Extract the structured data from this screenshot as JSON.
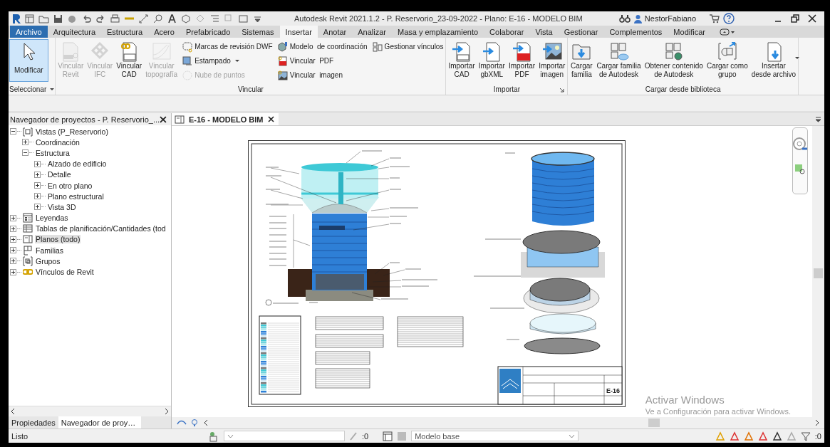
{
  "title_bar": {
    "title": "Autodesk Revit 2021.1.2 - P. Reservorio_23-09-2022 - Plano: E-16 - MODELO BIM",
    "user": "NestorFabiano"
  },
  "menu_tabs": [
    {
      "label": "Archivo",
      "kind": "file",
      "selected": false
    },
    {
      "label": "Arquitectura",
      "kind": "tab",
      "selected": false
    },
    {
      "label": "Estructura",
      "kind": "tab",
      "selected": false
    },
    {
      "label": "Acero",
      "kind": "tab",
      "selected": false
    },
    {
      "label": "Prefabricado",
      "kind": "tab",
      "selected": false
    },
    {
      "label": "Sistemas",
      "kind": "tab",
      "selected": false
    },
    {
      "label": "Insertar",
      "kind": "tab",
      "selected": true
    },
    {
      "label": "Anotar",
      "kind": "tab",
      "selected": false
    },
    {
      "label": "Analizar",
      "kind": "tab",
      "selected": false
    },
    {
      "label": "Masa y emplazamiento",
      "kind": "tab",
      "selected": false
    },
    {
      "label": "Colaborar",
      "kind": "tab",
      "selected": false
    },
    {
      "label": "Vista",
      "kind": "tab",
      "selected": false
    },
    {
      "label": "Gestionar",
      "kind": "tab",
      "selected": false
    },
    {
      "label": "Complementos",
      "kind": "tab",
      "selected": false
    },
    {
      "label": "Modificar",
      "kind": "tab",
      "selected": false
    }
  ],
  "ribbon_panels": [
    {
      "label": "Seleccionar",
      "dropdown": true,
      "launcher": false,
      "items": [
        {
          "kind": "large",
          "label": "Modificar",
          "active": true,
          "disabled": false,
          "dropdown": false
        }
      ]
    },
    {
      "label": "Vincular",
      "dropdown": false,
      "launcher": false,
      "items": [
        {
          "kind": "large",
          "label": "Vincular\nRevit",
          "active": false,
          "disabled": true,
          "dropdown": false
        },
        {
          "kind": "large",
          "label": "Vincular\nIFC",
          "active": false,
          "disabled": true,
          "dropdown": false
        },
        {
          "kind": "large",
          "label": "Vincular\nCAD",
          "active": false,
          "disabled": false,
          "dropdown": false
        },
        {
          "kind": "large",
          "label": "Vincular\ntopografía",
          "active": false,
          "disabled": true,
          "dropdown": false
        },
        {
          "kind": "stack",
          "items": [
            {
              "label": "Marcas de revisión DWF",
              "disabled": false,
              "dropdown": false
            },
            {
              "label": "Estampado",
              "disabled": false,
              "dropdown": true
            },
            {
              "label": "Nube de puntos",
              "disabled": true,
              "dropdown": false
            }
          ]
        },
        {
          "kind": "stack",
          "items": [
            {
              "label": "Modelo  de coordinación",
              "disabled": false,
              "dropdown": false
            },
            {
              "label": "Vincular  PDF",
              "disabled": false,
              "dropdown": false
            },
            {
              "label": "Vincular  imagen",
              "disabled": false,
              "dropdown": false
            }
          ]
        },
        {
          "kind": "stack",
          "items": [
            {
              "label": "Gestionar vínculos",
              "disabled": false,
              "dropdown": false
            }
          ]
        }
      ]
    },
    {
      "label": "Importar",
      "dropdown": false,
      "launcher": true,
      "items": [
        {
          "kind": "large",
          "label": "Importar\nCAD",
          "active": false,
          "disabled": false,
          "dropdown": false
        },
        {
          "kind": "large",
          "label": "Importar\ngbXML",
          "active": false,
          "disabled": false,
          "dropdown": false
        },
        {
          "kind": "large",
          "label": "Importar\nPDF",
          "active": false,
          "disabled": false,
          "dropdown": false
        },
        {
          "kind": "large",
          "label": "Importar\nimagen",
          "active": false,
          "disabled": false,
          "dropdown": false
        }
      ]
    },
    {
      "label": "Cargar desde biblioteca",
      "dropdown": false,
      "launcher": false,
      "items": [
        {
          "kind": "large",
          "label": "Cargar\nfamilia",
          "active": false,
          "disabled": false,
          "dropdown": false
        },
        {
          "kind": "large",
          "label": "Cargar familia\nde Autodesk",
          "active": false,
          "disabled": false,
          "dropdown": false
        },
        {
          "kind": "large",
          "label": "Obtener contenido\nde Autodesk",
          "active": false,
          "disabled": false,
          "dropdown": false
        },
        {
          "kind": "large",
          "label": "Cargar como\ngrupo",
          "active": false,
          "disabled": false,
          "dropdown": false
        },
        {
          "kind": "large",
          "label": "Insertar\ndesde archivo",
          "active": false,
          "disabled": false,
          "dropdown": true
        }
      ]
    }
  ],
  "project_browser": {
    "title": "Navegador de proyectos - P. Reservorio_...",
    "tree": [
      {
        "label": "Vistas (P_Reservorio)",
        "expanded": true,
        "selected": false,
        "children": [
          {
            "label": "Coordinación",
            "expanded": false,
            "selected": false
          },
          {
            "label": "Estructura",
            "expanded": true,
            "selected": false,
            "children": [
              {
                "label": "Alzado de edificio",
                "expanded": false,
                "selected": false
              },
              {
                "label": "Detalle",
                "expanded": false,
                "selected": false
              },
              {
                "label": "En otro plano",
                "expanded": false,
                "selected": false
              },
              {
                "label": "Plano estructural",
                "expanded": false,
                "selected": false
              },
              {
                "label": "Vista 3D",
                "expanded": false,
                "selected": false
              }
            ]
          }
        ]
      },
      {
        "label": "Leyendas",
        "expanded": false,
        "selected": false
      },
      {
        "label": "Tablas de planificación/Cantidades (tod",
        "expanded": false,
        "selected": false
      },
      {
        "label": "Planos (todo)",
        "expanded": false,
        "selected": true
      },
      {
        "label": "Familias",
        "expanded": false,
        "selected": false
      },
      {
        "label": "Grupos",
        "expanded": false,
        "selected": false
      },
      {
        "label": "Vínculos de Revit",
        "expanded": false,
        "selected": false
      }
    ]
  },
  "panel_tabs": [
    {
      "label": "Propiedades",
      "selected": false
    },
    {
      "label": "Navegador de proy…",
      "selected": true
    }
  ],
  "view_tab": {
    "label": "E-16 - MODELO BIM"
  },
  "sheet": {
    "sheet_number": "E-16"
  },
  "activation_notice": {
    "title": "Activar Windows",
    "message": "Ve a Configuración para activar Windows."
  },
  "status_bar": {
    "text": "Listo",
    "link_count": ":0",
    "model": "Modelo base",
    "filter_count": ":0"
  }
}
